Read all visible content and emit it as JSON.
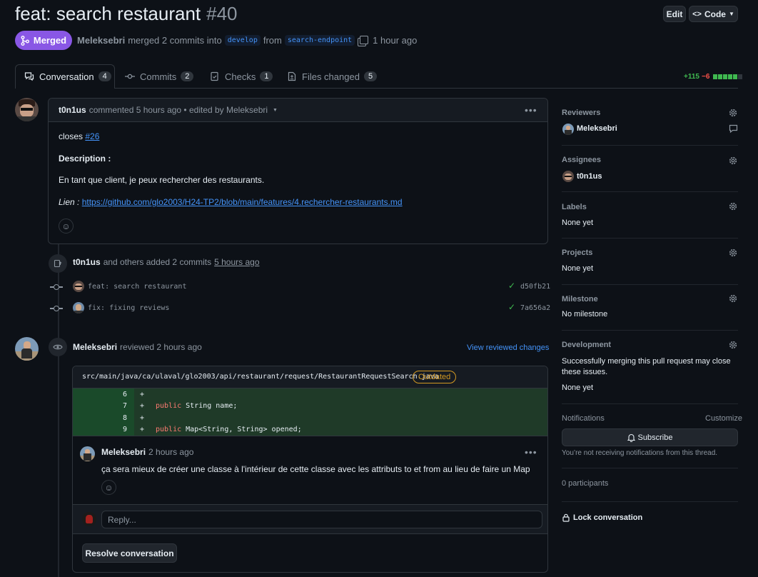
{
  "pr": {
    "title": "feat: search restaurant",
    "number": "#40",
    "state": "Merged",
    "author": "Meleksebri",
    "merge_text": "merged 2 commits into",
    "base_branch": "develop",
    "from_text": "from",
    "head_branch": "search-endpoint",
    "time": "1 hour ago"
  },
  "header_buttons": {
    "edit": "Edit",
    "code": "Code"
  },
  "tabs": [
    {
      "label": "Conversation",
      "count": "4"
    },
    {
      "label": "Commits",
      "count": "2"
    },
    {
      "label": "Checks",
      "count": "1"
    },
    {
      "label": "Files changed",
      "count": "5"
    }
  ],
  "diffstat": {
    "added": "+115",
    "removed": "−6"
  },
  "comment1": {
    "author": "t0n1us",
    "meta": "commented 5 hours ago • edited by Meleksebri",
    "closes_text": "closes",
    "closes_link": "#26",
    "description": "Description :",
    "body": "En tant que client, je peux rechercher des restaurants.",
    "lien_label": "Lien :",
    "lien_url": "https://github.com/glo2003/H24-TP2/blob/main/features/4.rechercher-restaurants.md"
  },
  "commits_event": {
    "author": "t0n1us",
    "text": "and others added 2 commits",
    "time": "5 hours ago",
    "commits": [
      {
        "message": "feat: search restaurant",
        "sha": "d50fb21"
      },
      {
        "message": "fix: fixing reviews",
        "sha": "7a656a2"
      }
    ]
  },
  "review": {
    "author": "Meleksebri",
    "meta": "reviewed 2 hours ago",
    "view_link": "View reviewed changes",
    "file": "src/main/java/ca/ulaval/glo2003/api/restaurant/request/RestaurantRequestSearch.java",
    "outdated": "Outdated",
    "lines": [
      {
        "num": "6",
        "keyword": "",
        "code": ""
      },
      {
        "num": "7",
        "keyword": "public",
        "code": " String name;"
      },
      {
        "num": "8",
        "keyword": "",
        "code": ""
      },
      {
        "num": "9",
        "keyword": "public",
        "code": " Map<String, String> opened;"
      }
    ],
    "comment_author": "Meleksebri",
    "comment_time": "2 hours ago",
    "comment_body": "ça sera mieux de créer une classe à l'intérieur de cette classe avec les attributs to et from au lieu de faire un Map",
    "reply_placeholder": "Reply...",
    "resolve": "Resolve conversation"
  },
  "sidebar": {
    "reviewers": {
      "title": "Reviewers",
      "value": "Meleksebri"
    },
    "assignees": {
      "title": "Assignees",
      "value": "t0n1us"
    },
    "labels": {
      "title": "Labels",
      "value": "None yet"
    },
    "projects": {
      "title": "Projects",
      "value": "None yet"
    },
    "milestone": {
      "title": "Milestone",
      "value": "No milestone"
    },
    "development": {
      "title": "Development",
      "text": "Successfully merging this pull request may close these issues.",
      "value": "None yet"
    },
    "notifications": {
      "title": "Notifications",
      "customize": "Customize",
      "subscribe": "Subscribe",
      "note": "You’re not receiving notifications from this thread."
    },
    "participants": "0 participants",
    "lock": "Lock conversation"
  },
  "colors": {
    "merged": "#8957e5",
    "added": "#3fb950",
    "removed": "#f85149",
    "link": "#4493f8",
    "outdated": "#d29922"
  }
}
